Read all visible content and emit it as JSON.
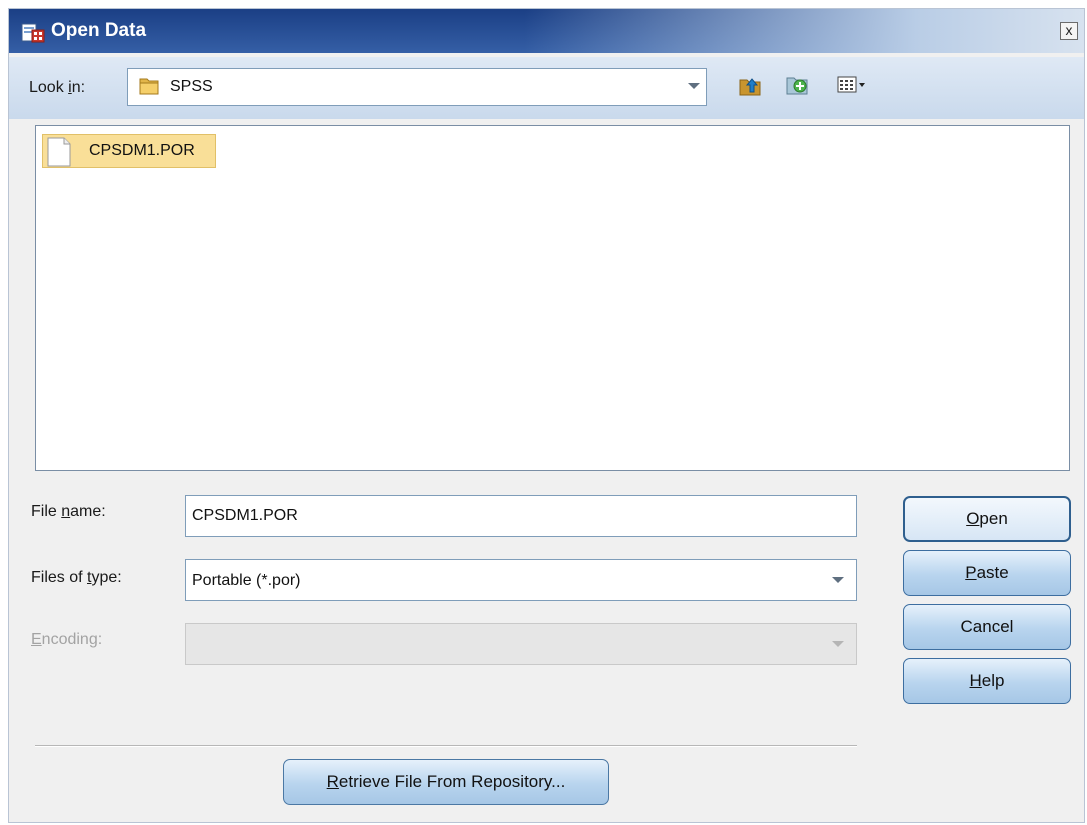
{
  "window": {
    "title": "Open Data",
    "close_label": "x"
  },
  "look_in": {
    "label_pre": "Look ",
    "label_accel": "i",
    "label_post": "n:",
    "value": "SPSS"
  },
  "toolbar": {
    "icons": [
      "up-folder-icon",
      "new-folder-icon",
      "view-menu-icon"
    ]
  },
  "files": [
    {
      "name": "CPSDM1.POR",
      "selected": true
    }
  ],
  "file_name": {
    "label_pre": "File ",
    "label_accel": "n",
    "label_post": "ame:",
    "value": "CPSDM1.POR"
  },
  "files_of_type": {
    "label_pre": "Files of ",
    "label_accel": "t",
    "label_post": "ype:",
    "value": "Portable (*.por)"
  },
  "encoding": {
    "label_accel": "E",
    "label_post": "ncoding:",
    "value": "",
    "disabled": true
  },
  "buttons": {
    "open": {
      "accel": "O",
      "rest": "pen"
    },
    "paste": {
      "accel": "P",
      "rest": "aste"
    },
    "cancel": {
      "label": "Cancel"
    },
    "help": {
      "accel": "H",
      "rest": "elp"
    },
    "retrieve": {
      "accel": "R",
      "rest": "etrieve File From Repository..."
    }
  },
  "colors": {
    "title_bar": "#1b3f85",
    "selection": "#f9df98",
    "button_face": "#b8d4ee"
  }
}
